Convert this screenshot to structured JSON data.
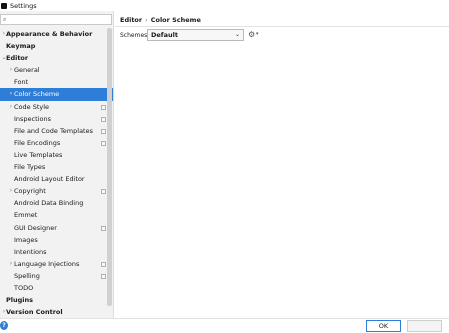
{
  "window": {
    "title": "Settings"
  },
  "sidebar": {
    "search_placeholder": "",
    "items": [
      {
        "label": "Appearance & Behavior",
        "level": 0,
        "arrow": "›",
        "bold": true
      },
      {
        "label": "Keymap",
        "level": 0,
        "arrow": "",
        "bold": true
      },
      {
        "label": "Editor",
        "level": 0,
        "arrow": "⌄",
        "bold": true
      },
      {
        "label": "General",
        "level": 1,
        "arrow": "›"
      },
      {
        "label": "Font",
        "level": 1,
        "arrow": ""
      },
      {
        "label": "Color Scheme",
        "level": 1,
        "arrow": "›",
        "selected": true
      },
      {
        "label": "Code Style",
        "level": 1,
        "arrow": "›",
        "copy": true
      },
      {
        "label": "Inspections",
        "level": 1,
        "arrow": "",
        "copy": true
      },
      {
        "label": "File and Code Templates",
        "level": 1,
        "arrow": "",
        "copy": true
      },
      {
        "label": "File Encodings",
        "level": 1,
        "arrow": "",
        "copy": true
      },
      {
        "label": "Live Templates",
        "level": 1,
        "arrow": ""
      },
      {
        "label": "File Types",
        "level": 1,
        "arrow": ""
      },
      {
        "label": "Android Layout Editor",
        "level": 1,
        "arrow": ""
      },
      {
        "label": "Copyright",
        "level": 1,
        "arrow": "›",
        "copy": true
      },
      {
        "label": "Android Data Binding",
        "level": 1,
        "arrow": ""
      },
      {
        "label": "Emmet",
        "level": 1,
        "arrow": ""
      },
      {
        "label": "GUI Designer",
        "level": 1,
        "arrow": "",
        "copy": true
      },
      {
        "label": "Images",
        "level": 1,
        "arrow": ""
      },
      {
        "label": "Intentions",
        "level": 1,
        "arrow": ""
      },
      {
        "label": "Language Injections",
        "level": 1,
        "arrow": "›",
        "copy": true
      },
      {
        "label": "Spelling",
        "level": 1,
        "arrow": "",
        "copy": true
      },
      {
        "label": "TODO",
        "level": 1,
        "arrow": ""
      },
      {
        "label": "Plugins",
        "level": 0,
        "arrow": "",
        "bold": true
      },
      {
        "label": "Version Control",
        "level": 0,
        "arrow": "›",
        "bold": true
      }
    ]
  },
  "main": {
    "breadcrumb": [
      "Editor",
      "Color Scheme"
    ],
    "breadcrumb_separator": "›",
    "scheme_label": "Schemes:",
    "scheme_value": "Default"
  },
  "footer": {
    "ok_label": "OK",
    "help_label": "?"
  },
  "colors": {
    "selection": "#2e7dd8",
    "sidebar_bg": "#f2f2f2"
  }
}
